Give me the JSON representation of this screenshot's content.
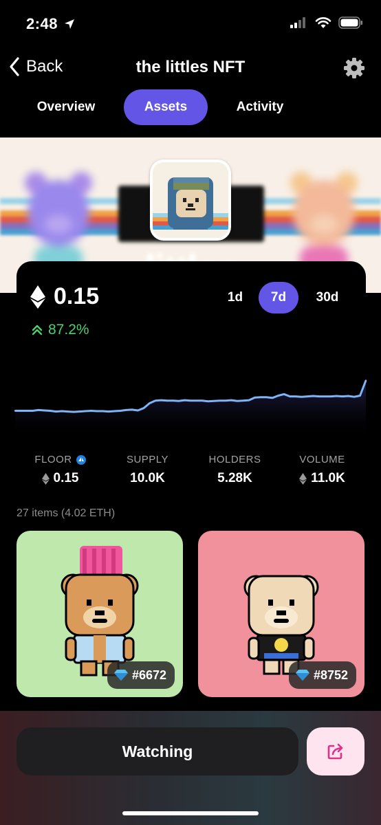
{
  "status": {
    "time": "2:48"
  },
  "nav": {
    "back_label": "Back",
    "title": "the littles NFT"
  },
  "tabs": [
    {
      "label": "Overview",
      "active": false
    },
    {
      "label": "Assets",
      "active": true
    },
    {
      "label": "Activity",
      "active": false
    }
  ],
  "banner": {
    "logo_text": "the littles"
  },
  "price": {
    "value": "0.15",
    "change": "87.2%",
    "currency_icon": "ethereum-icon"
  },
  "ranges": [
    {
      "label": "1d",
      "active": false
    },
    {
      "label": "7d",
      "active": true
    },
    {
      "label": "30d",
      "active": false
    }
  ],
  "chart_data": {
    "type": "line",
    "period": "7d",
    "x": [
      0,
      1,
      2,
      3,
      4,
      5,
      6,
      7,
      8,
      9,
      10,
      11,
      12,
      13,
      14,
      15,
      16,
      17,
      18,
      19,
      20,
      21,
      22,
      23,
      24,
      25,
      26,
      27,
      28,
      29,
      30,
      31,
      32,
      33,
      34,
      35,
      36,
      37,
      38,
      39,
      40,
      41,
      42,
      43,
      44,
      45,
      46,
      47,
      48,
      49,
      50,
      51,
      52,
      53,
      54,
      55,
      56,
      57,
      58,
      59,
      60
    ],
    "values": [
      0.07,
      0.07,
      0.07,
      0.07,
      0.072,
      0.071,
      0.07,
      0.068,
      0.069,
      0.068,
      0.067,
      0.068,
      0.069,
      0.07,
      0.069,
      0.069,
      0.068,
      0.069,
      0.07,
      0.072,
      0.073,
      0.071,
      0.077,
      0.09,
      0.097,
      0.098,
      0.097,
      0.097,
      0.096,
      0.098,
      0.097,
      0.097,
      0.097,
      0.095,
      0.096,
      0.097,
      0.097,
      0.098,
      0.096,
      0.097,
      0.098,
      0.105,
      0.106,
      0.106,
      0.104,
      0.11,
      0.114,
      0.108,
      0.108,
      0.107,
      0.108,
      0.109,
      0.108,
      0.108,
      0.108,
      0.109,
      0.108,
      0.109,
      0.107,
      0.11,
      0.15
    ],
    "ylim": [
      0,
      0.16
    ],
    "color": "#7fb4f6",
    "grid": false,
    "legend": "none"
  },
  "stats": [
    {
      "label": "FLOOR",
      "value": "0.15",
      "eth": true,
      "badge": true
    },
    {
      "label": "SUPPLY",
      "value": "10.0K",
      "eth": false,
      "badge": false
    },
    {
      "label": "HOLDERS",
      "value": "5.28K",
      "eth": false,
      "badge": false
    },
    {
      "label": "VOLUME",
      "value": "11.0K",
      "eth": true,
      "badge": false
    }
  ],
  "items_count": "27 items (4.02 ETH)",
  "nfts": [
    {
      "id": "#6672",
      "bg": "#bfe8ad"
    },
    {
      "id": "#8752",
      "bg": "#f0919c"
    }
  ],
  "bottom": {
    "watching_label": "Watching"
  },
  "colors": {
    "accent": "#6355e6",
    "positive": "#4cd26a"
  }
}
